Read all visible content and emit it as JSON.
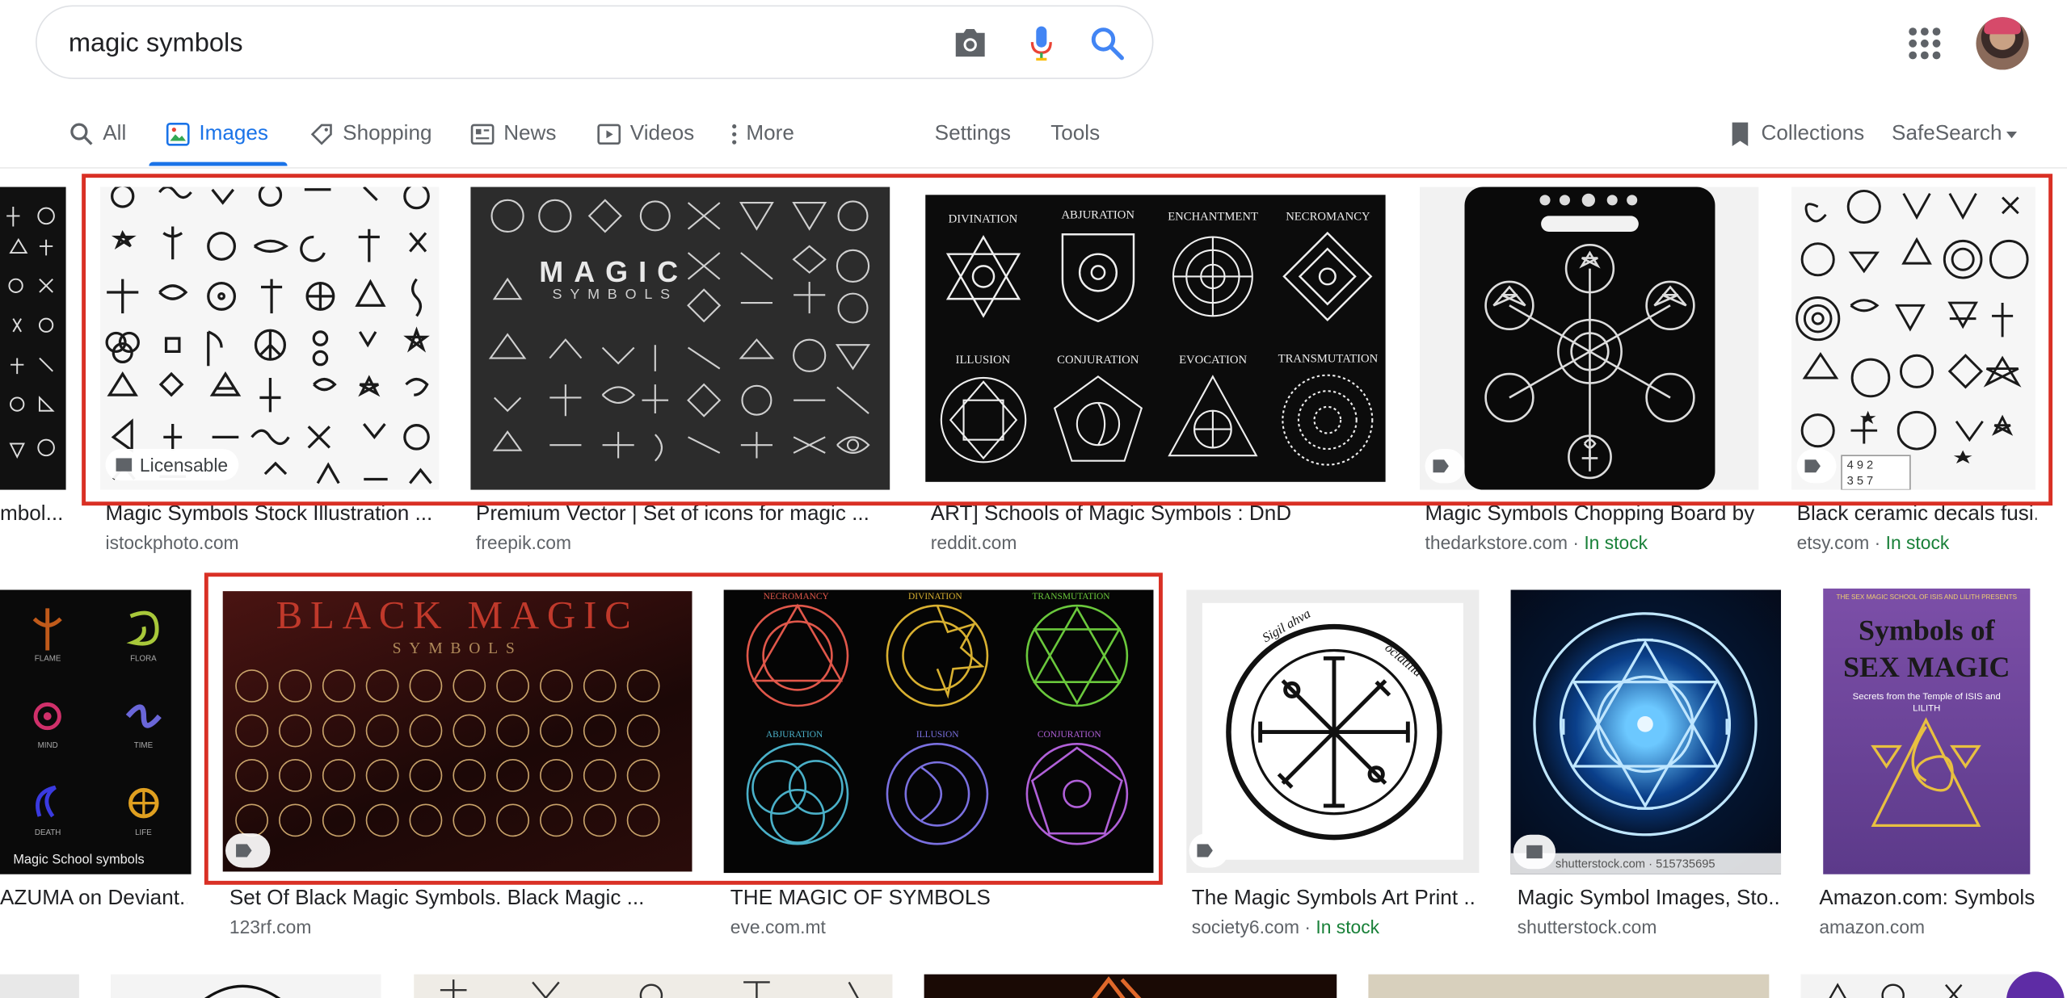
{
  "search": {
    "query": "magic symbols"
  },
  "tabs": [
    {
      "label": "All",
      "icon": "search-icon"
    },
    {
      "label": "Images",
      "icon": "image-icon",
      "active": true
    },
    {
      "label": "Shopping",
      "icon": "tag-icon"
    },
    {
      "label": "News",
      "icon": "news-icon"
    },
    {
      "label": "Videos",
      "icon": "play-icon"
    },
    {
      "label": "More",
      "icon": "more-vert-icon"
    }
  ],
  "tools": {
    "settings": "Settings",
    "tools": "Tools",
    "collections": "Collections",
    "safesearch": "SafeSearch"
  },
  "row1": [
    {
      "title": "mbol...",
      "source": ""
    },
    {
      "title": "Magic Symbols Stock Illustration ...",
      "source": "istockphoto.com",
      "badge": "Licensable"
    },
    {
      "title": "Premium Vector | Set of icons for magic ...",
      "source": "freepik.com",
      "overlay_title": "MAGIC",
      "overlay_sub": "SYMBOLS"
    },
    {
      "title": "ART] Schools of Magic Symbols : DnD",
      "source": "reddit.com",
      "labels": [
        "DIVINATION",
        "ABJURATION",
        "ENCHANTMENT",
        "NECROMANCY",
        "ILLUSION",
        "CONJURATION",
        "EVOCATION",
        "TRANSMUTATION"
      ]
    },
    {
      "title": "Magic Symbols Chopping Board by...",
      "source": "thedarkstore.com",
      "stock": "In stock"
    },
    {
      "title": "Black ceramic decals fusi...",
      "source": "etsy.com",
      "stock": "In stock"
    }
  ],
  "row2": [
    {
      "title": "AZUMA on Deviant...",
      "source": "",
      "caption_in_image": "Magic School symbols",
      "labels": [
        "FLAME",
        "FLORA",
        "MIND",
        "TIME",
        "DEATH",
        "LIFE"
      ]
    },
    {
      "title": "Set Of Black Magic Symbols. Black Magic ...",
      "source": "123rf.com",
      "overlay_title": "BLACK MAGIC",
      "overlay_sub": "SYMBOLS"
    },
    {
      "title": "THE MAGIC OF SYMBOLS",
      "source": "eve.com.mt",
      "labels": [
        "NECROMANCY",
        "DIVINATION",
        "TRANSMUTATION",
        "ABJURATION",
        "ILLUSION",
        "CONJURATION"
      ]
    },
    {
      "title": "The Magic Symbols Art Print ...",
      "source": "society6.com",
      "stock": "In stock"
    },
    {
      "title": "Magic Symbol Images, Sto...",
      "source": "shutterstock.com",
      "watermark": "shutterstock.com · 515735695"
    },
    {
      "title": "Amazon.com: Symbols...",
      "source": "amazon.com",
      "book_title": "Symbols of SEX MAGIC",
      "book_sub": "Secrets from the Temple of ISIS and LILITH",
      "book_top": "THE SEX MAGIC SCHOOL OF ISIS AND LILITH PRESENTS"
    }
  ],
  "colors": {
    "accent": "#1a73e8",
    "highlight": "#d93025",
    "stock": "#188038"
  }
}
